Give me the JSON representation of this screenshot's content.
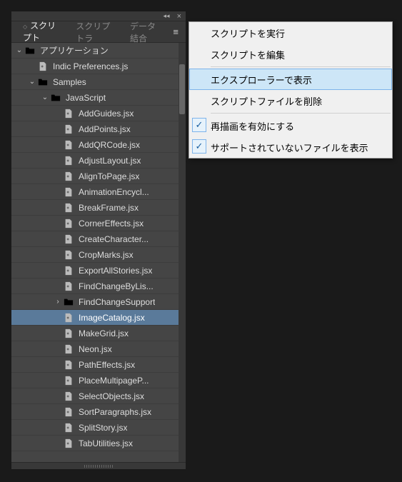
{
  "tabs": {
    "active": "スクリプト",
    "inactive1": "スクリプトラ",
    "inactive2": "データ結合"
  },
  "tree": {
    "root": {
      "label": "アプリケーション"
    },
    "indic": {
      "label": "Indic Preferences.js"
    },
    "samples": {
      "label": "Samples"
    },
    "javascript": {
      "label": "JavaScript"
    },
    "findChangeSupport": {
      "label": "FindChangeSupport"
    },
    "items": [
      "AddGuides.jsx",
      "AddPoints.jsx",
      "AddQRCode.jsx",
      "AdjustLayout.jsx",
      "AlignToPage.jsx",
      "AnimationEncycl...",
      "BreakFrame.jsx",
      "CornerEffects.jsx",
      "CreateCharacter...",
      "CropMarks.jsx",
      "ExportAllStories.jsx",
      "FindChangeByLis...",
      "ImageCatalog.jsx",
      "MakeGrid.jsx",
      "Neon.jsx",
      "PathEffects.jsx",
      "PlaceMultipageP...",
      "SelectObjects.jsx",
      "SortParagraphs.jsx",
      "SplitStory.jsx",
      "TabUtilities.jsx"
    ],
    "selected": "ImageCatalog.jsx"
  },
  "ctx": {
    "run": "スクリプトを実行",
    "edit": "スクリプトを編集",
    "reveal": "エクスプローラーで表示",
    "delete": "スクリプトファイルを削除",
    "redraw": "再描画を有効にする",
    "unsupported": "サポートされていないファイルを表示",
    "hovered": "reveal",
    "checked": [
      "redraw",
      "unsupported"
    ]
  }
}
